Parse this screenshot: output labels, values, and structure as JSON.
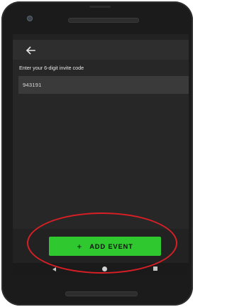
{
  "screen": {
    "prompt": "Enter your 6-digit invite code",
    "invite_code_value": "943191",
    "back_icon": "arrow-left-icon"
  },
  "actions": {
    "add_event_plus": "+",
    "add_event_label": "ADD EVENT"
  },
  "nav": {
    "back_icon": "nav-back-triangle-icon",
    "home_icon": "nav-home-circle-icon",
    "recents_icon": "nav-recents-square-icon"
  },
  "colors": {
    "screen_bg": "#272727",
    "button_green": "#2fc92f",
    "annotation_red": "#d81f26"
  }
}
